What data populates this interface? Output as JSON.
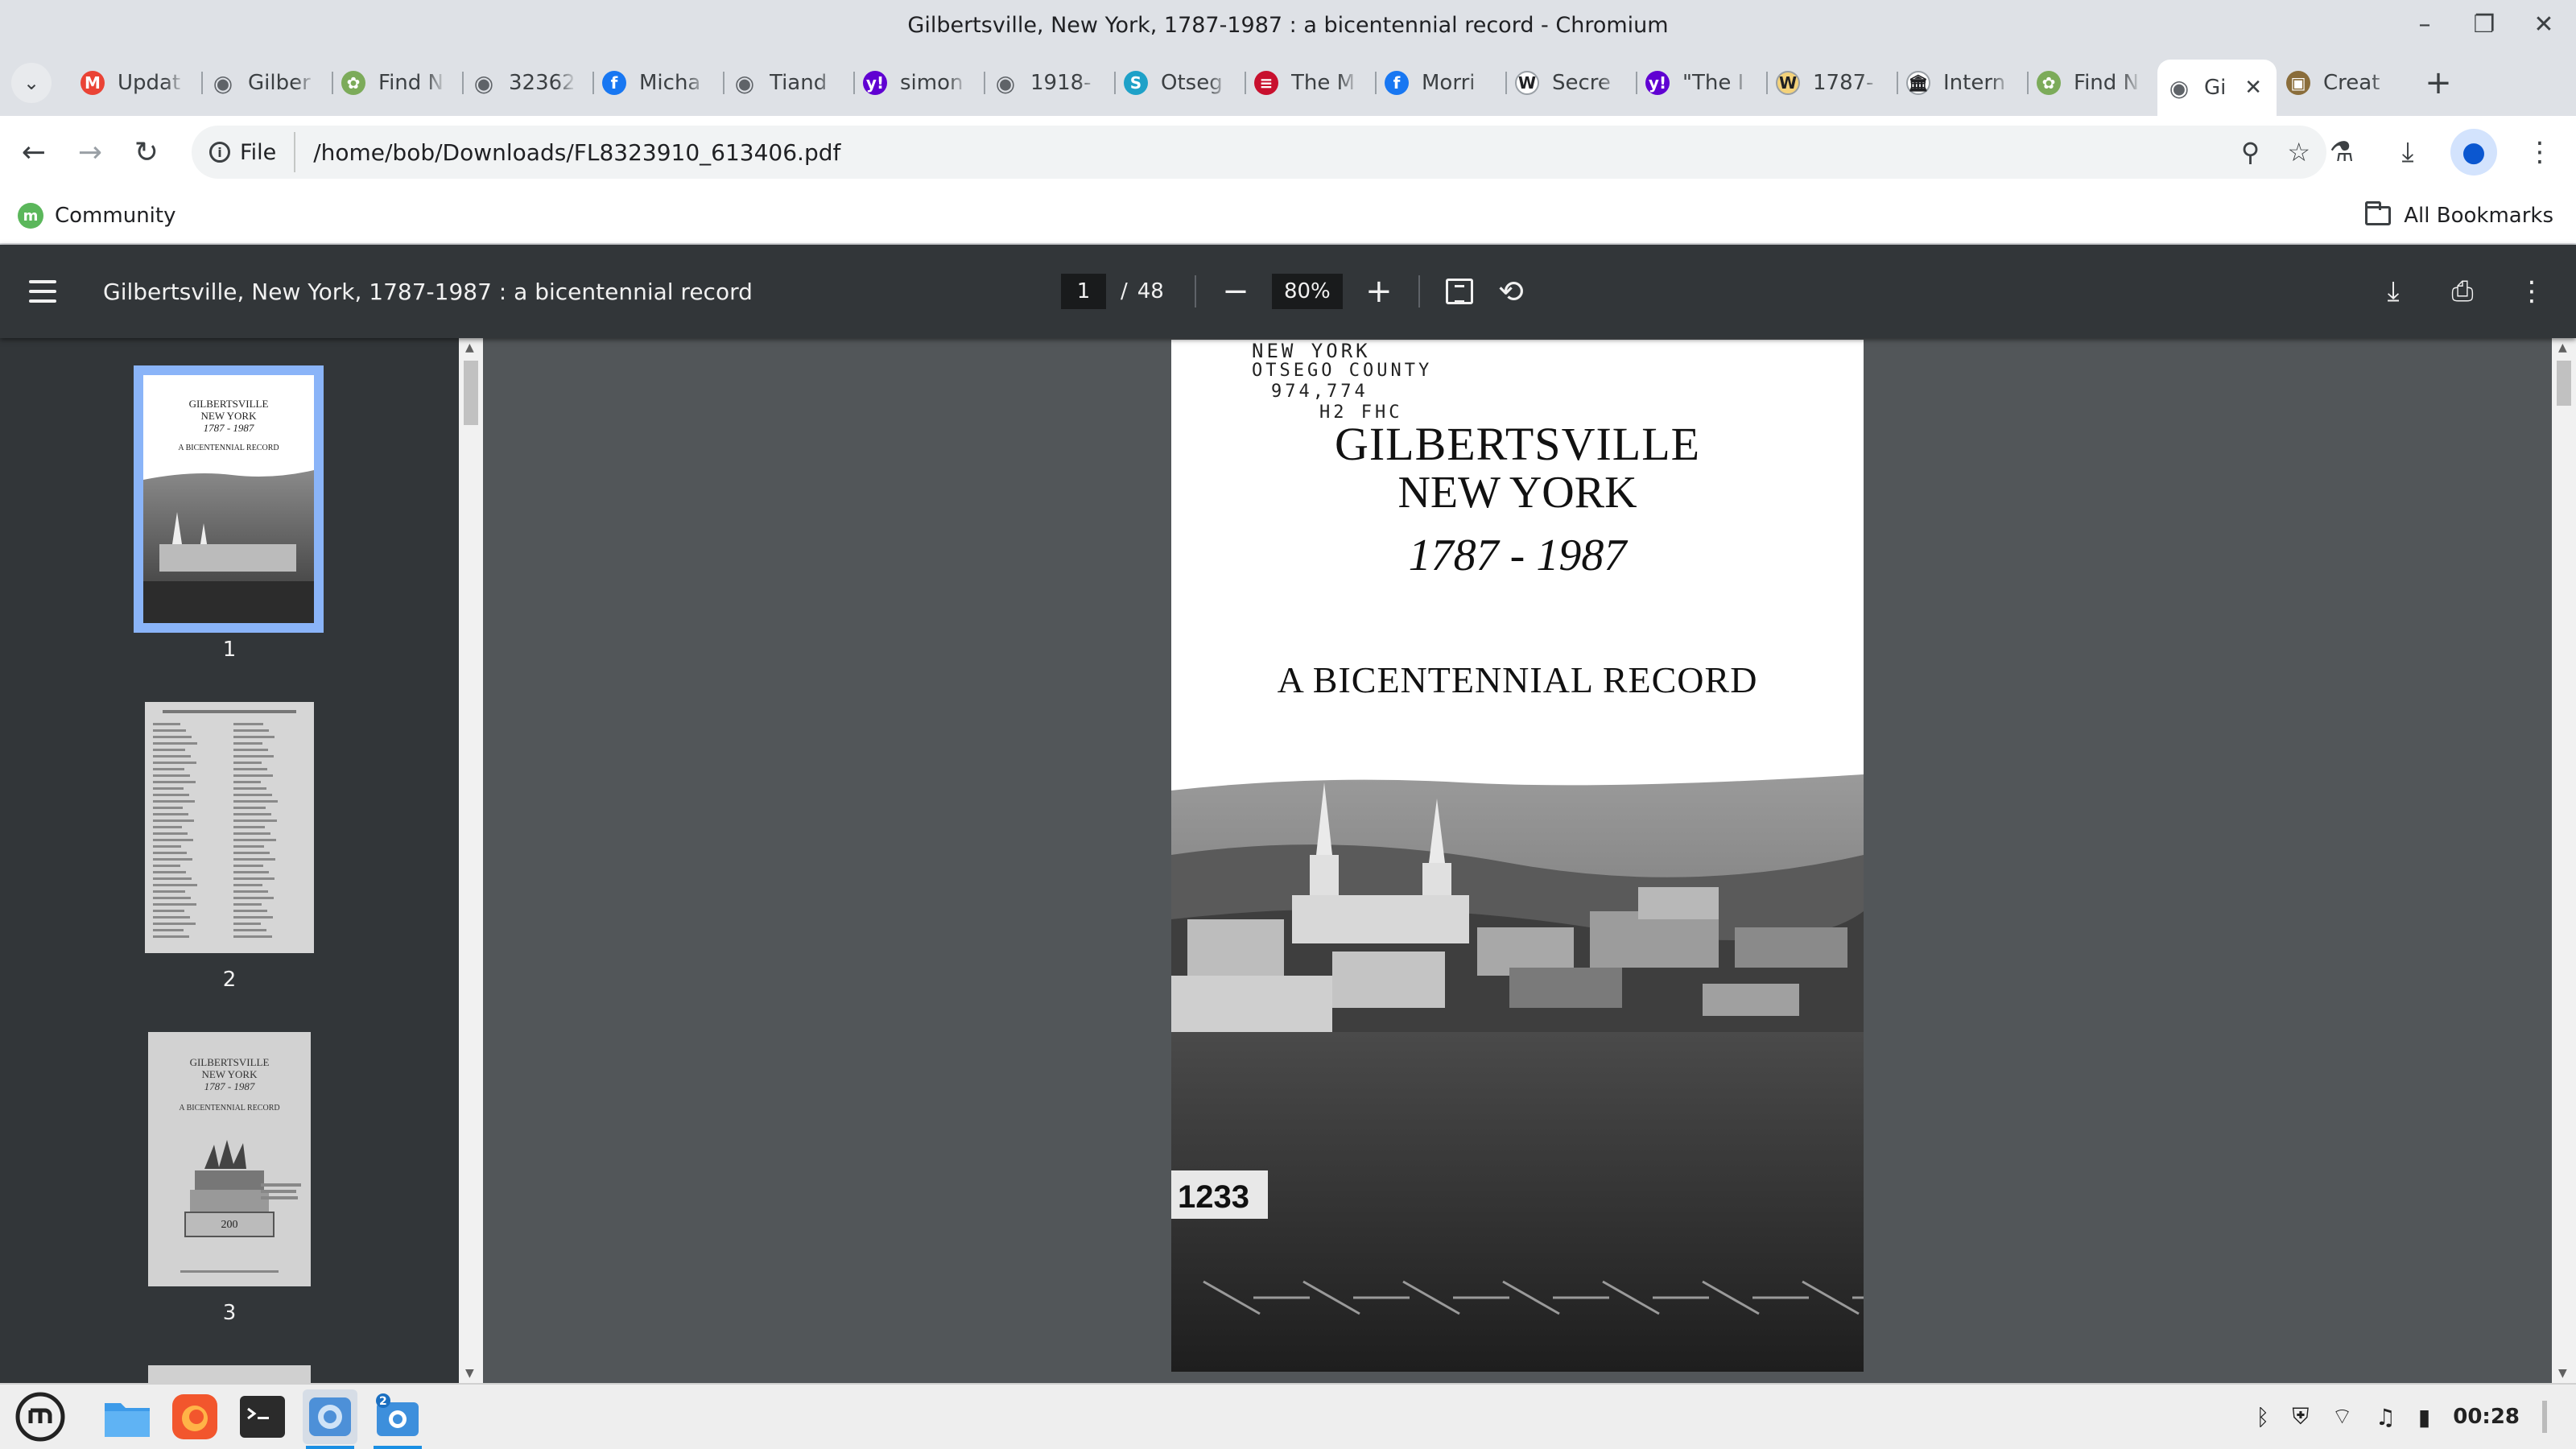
{
  "window": {
    "title": "Gilbertsville, New York, 1787-1987 : a bicentennial record - Chromium"
  },
  "tabs": [
    {
      "label": "Updat",
      "icon": "gmail-icon",
      "color": "#ea4335",
      "glyph": "M"
    },
    {
      "label": "Gilber",
      "icon": "globe-icon",
      "color": "#5f6368",
      "glyph": "◉"
    },
    {
      "label": "Find N",
      "icon": "findagrave-icon",
      "color": "#7cab5a",
      "glyph": "✿"
    },
    {
      "label": "32362",
      "icon": "globe-icon",
      "color": "#5f6368",
      "glyph": "◉"
    },
    {
      "label": "Micha",
      "icon": "facebook-icon",
      "color": "#1877f2",
      "glyph": "f"
    },
    {
      "label": "Tiand",
      "icon": "globe-icon",
      "color": "#5f6368",
      "glyph": "◉"
    },
    {
      "label": "simon",
      "icon": "yahoo-icon",
      "color": "#6001d2",
      "glyph": "y!"
    },
    {
      "label": "1918-",
      "icon": "globe-icon",
      "color": "#5f6368",
      "glyph": "◉"
    },
    {
      "label": "Otseg",
      "icon": "otsego-icon",
      "color": "#1ea1c8",
      "glyph": "S"
    },
    {
      "label": "The M",
      "icon": "flag-icon",
      "color": "#c8102e",
      "glyph": "≡"
    },
    {
      "label": "Morri",
      "icon": "facebook-icon",
      "color": "#1877f2",
      "glyph": "f"
    },
    {
      "label": "Secre",
      "icon": "wikipedia-icon",
      "color": "#ffffff",
      "glyph": "W"
    },
    {
      "label": "\"The I",
      "icon": "yahoo-icon",
      "color": "#6001d2",
      "glyph": "y!"
    },
    {
      "label": "1787-",
      "icon": "wikitree-icon",
      "color": "#f4d27a",
      "glyph": "W"
    },
    {
      "label": "Intern",
      "icon": "archive-icon",
      "color": "#ffffff",
      "glyph": "🏛"
    },
    {
      "label": "Find N",
      "icon": "findagrave-icon",
      "color": "#7cab5a",
      "glyph": "✿"
    },
    {
      "label": "Gi",
      "icon": "globe-icon",
      "color": "#5f6368",
      "glyph": "◉",
      "active": true
    },
    {
      "label": "Creat",
      "icon": "photo-icon",
      "color": "#8a6d3b",
      "glyph": "▣"
    }
  ],
  "toolbar": {
    "chip_label": "File",
    "url": "/home/bob/Downloads/FL8323910_613406.pdf"
  },
  "bookmarks": {
    "items": [
      {
        "label": "Community"
      }
    ],
    "all_label": "All Bookmarks"
  },
  "pdf": {
    "title": "Gilbertsville, New York, 1787-1987 : a bicentennial record",
    "current_page": "1",
    "page_separator": "/",
    "total_pages": "48",
    "zoom": "80%"
  },
  "thumbnails": [
    {
      "num": "1",
      "selected": true
    },
    {
      "num": "2",
      "selected": false
    },
    {
      "num": "3",
      "selected": false
    }
  ],
  "cover": {
    "handwritten": [
      "NEW YORK",
      "OTSEGO COUNTY",
      "974,774",
      "H2   FHC"
    ],
    "title_line1": "GILBERTSVILLE",
    "title_line2": "NEW  YORK",
    "years": "1787 - 1987",
    "subtitle": "A BICENTENNIAL RECORD",
    "photo_tag": "1233"
  },
  "thumb_text": {
    "t1_line1": "GILBERTSVILLE",
    "t1_line2": "NEW YORK",
    "t1_line3": "1787 - 1987",
    "t1_line4": "A BICENTENNIAL RECORD",
    "t3_line1": "GILBERTSVILLE",
    "t3_line2": "NEW YORK",
    "t3_line3": "1787 - 1987",
    "t3_line4": "A BICENTENNIAL RECORD",
    "t3_cake": "200"
  },
  "taskbar": {
    "notification_badge": "2",
    "clock": "00:28"
  }
}
